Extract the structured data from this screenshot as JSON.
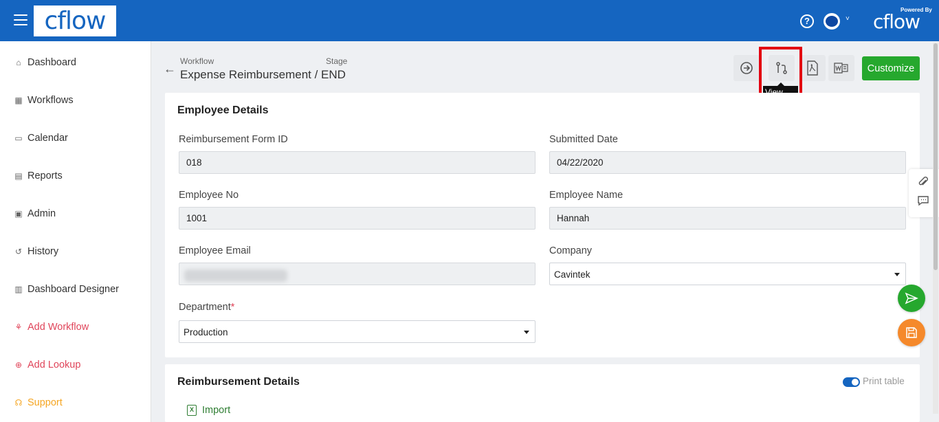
{
  "topbar": {
    "logo": "cflow",
    "powered_by": "Powered By",
    "brand": "cflow",
    "help_icon": "question-circle-icon",
    "avatar_icon": "user-avatar",
    "chevron": "˅"
  },
  "sidebar": {
    "items": [
      {
        "label": "Dashboard",
        "icon": "home-icon"
      },
      {
        "label": "Workflows",
        "icon": "grid-icon"
      },
      {
        "label": "Calendar",
        "icon": "calendar-icon"
      },
      {
        "label": "Reports",
        "icon": "reports-icon"
      },
      {
        "label": "Admin",
        "icon": "admin-icon"
      },
      {
        "label": "History",
        "icon": "history-icon"
      },
      {
        "label": "Dashboard Designer",
        "icon": "designer-icon"
      },
      {
        "label": "Add Workflow",
        "icon": "add-workflow-icon"
      },
      {
        "label": "Add Lookup",
        "icon": "add-lookup-icon"
      },
      {
        "label": "Support",
        "icon": "headset-icon"
      }
    ]
  },
  "header": {
    "workflow_label": "Workflow",
    "stage_label": "Stage",
    "title": "Expense Reimbursement / END",
    "customize": "Customize",
    "tooltip": "View Request Flow"
  },
  "employee_details": {
    "title": "Employee Details",
    "fields": {
      "form_id": {
        "label": "Reimbursement Form ID",
        "value": "018"
      },
      "submitted_date": {
        "label": "Submitted Date",
        "value": "04/22/2020"
      },
      "employee_no": {
        "label": "Employee No",
        "value": "1001"
      },
      "employee_name": {
        "label": "Employee Name",
        "value": "Hannah"
      },
      "employee_email": {
        "label": "Employee Email",
        "value": ""
      },
      "company": {
        "label": "Company",
        "value": "Cavintek"
      },
      "department": {
        "label": "Department",
        "required": "*",
        "value": "Production"
      }
    }
  },
  "reimbursement_details": {
    "title": "Reimbursement Details",
    "print_table": "Print table",
    "import": "Import",
    "import_icon": "X"
  },
  "colors": {
    "topbar": "#1565c0",
    "customize": "#26a82e",
    "highlight": "#e3000f",
    "submit_fab": "#26a82e",
    "save_fab": "#f5892b"
  }
}
